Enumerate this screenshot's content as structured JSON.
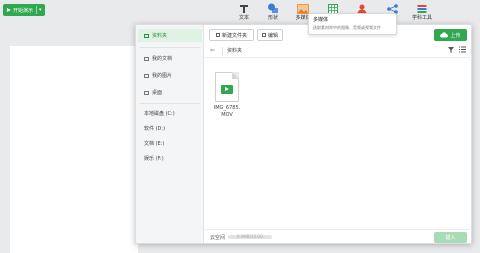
{
  "toolbar": {
    "start_label": "开始演示",
    "caret": "▾",
    "tools": [
      "文本",
      "形状",
      "多媒体",
      "",
      "",
      "",
      "学科工具"
    ]
  },
  "tooltip": {
    "title": "多媒体",
    "desc": "选取素材库中的图像、音频或视频文件"
  },
  "sidebar": {
    "items": [
      "资料夹",
      "我的文档",
      "我的图片",
      "桌面"
    ],
    "drives": [
      "本地磁盘 (C:)",
      "软件 (D:)",
      "文档 (E:)",
      "娱乐 (F:)"
    ]
  },
  "topbar": {
    "new_folder": "新建文件夹",
    "edit": "编辑",
    "upload": "上传"
  },
  "breadcrumb": {
    "back": "⇐",
    "current": "资料夹"
  },
  "files": [
    {
      "name": "IMG_6785.MOV"
    }
  ],
  "footer": {
    "storage_label": "云空间",
    "storage_text": "0.0MB/10.0G",
    "storage_fraction": 0.0,
    "insert_label": "插入"
  },
  "colors": {
    "accent": "#2fa84f",
    "accent_disabled": "#a8dcb6",
    "active_bg": "#dff2e3"
  }
}
